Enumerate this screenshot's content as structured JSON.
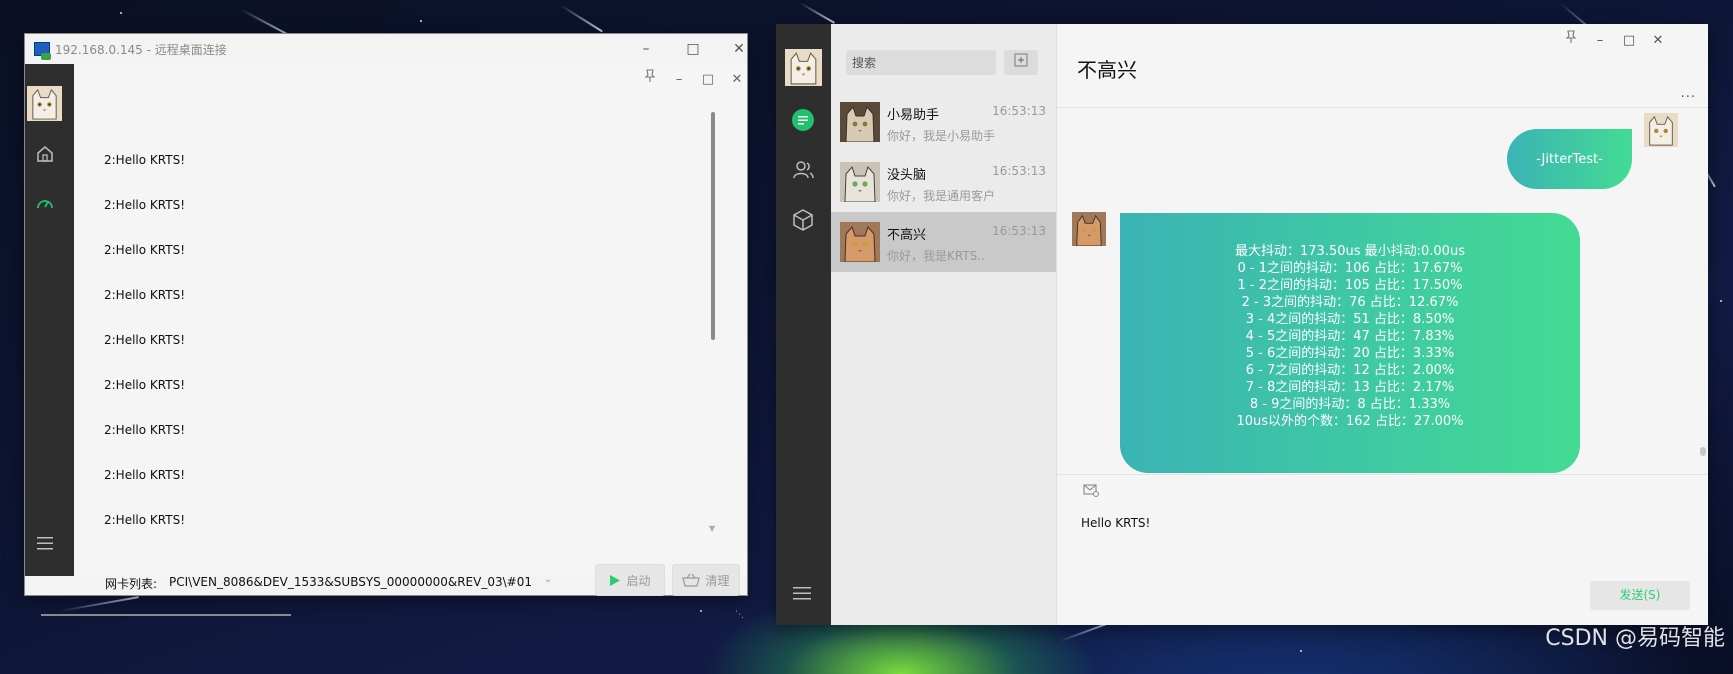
{
  "remote_desktop": {
    "title": "192.168.0.145 - 远程桌面连接",
    "log_lines": [
      "2:Hello KRTS!",
      "2:Hello KRTS!",
      "2:Hello KRTS!",
      "2:Hello KRTS!",
      "2:Hello KRTS!",
      "2:Hello KRTS!",
      "2:Hello KRTS!",
      "2:Hello KRTS!",
      "2:Hello KRTS!"
    ],
    "nic_label": "网卡列表:",
    "nic_value": "PCI\\VEN_8086&DEV_1533&SUBSYS_00000000&REV_03\\#01",
    "start_label": "启动",
    "clear_label": "清理"
  },
  "chat": {
    "search_placeholder": "搜索",
    "contacts": [
      {
        "name": "小易助手",
        "time": "16:53:13",
        "preview": "你好，我是小易助手"
      },
      {
        "name": "没头脑",
        "time": "16:53:13",
        "preview": "你好，我是通用客户"
      },
      {
        "name": "不高兴",
        "time": "16:53:13",
        "preview": "你好，我是KRTS.."
      }
    ],
    "title": "不高兴",
    "more": "...",
    "outgoing": "-JitterTest-",
    "incoming_lines": [
      "最大抖动：173.50us  最小抖动:0.00us",
      "0 - 1之间的抖动：106 占比：17.67%",
      "1 - 2之间的抖动：105 占比：17.50%",
      "2 - 3之间的抖动：76 占比：12.67%",
      "3 - 4之间的抖动：51 占比：8.50%",
      "4 - 5之间的抖动：47 占比：7.83%",
      "5 - 6之间的抖动：20 占比：3.33%",
      "6 - 7之间的抖动：12 占比：2.00%",
      "7 - 8之间的抖动：13 占比：2.17%",
      "8 - 9之间的抖动：8 占比：1.33%",
      "10us以外的个数：162 占比：27.00%"
    ],
    "draft": "Hello KRTS!",
    "send_label": "发送(S)"
  },
  "watermark": "CSDN @易码智能",
  "colors": {
    "accent_green": "#2ecc71",
    "bubble_start": "#3bb3b5",
    "bubble_end": "#43db93",
    "sidebar": "#2e2e2e"
  }
}
